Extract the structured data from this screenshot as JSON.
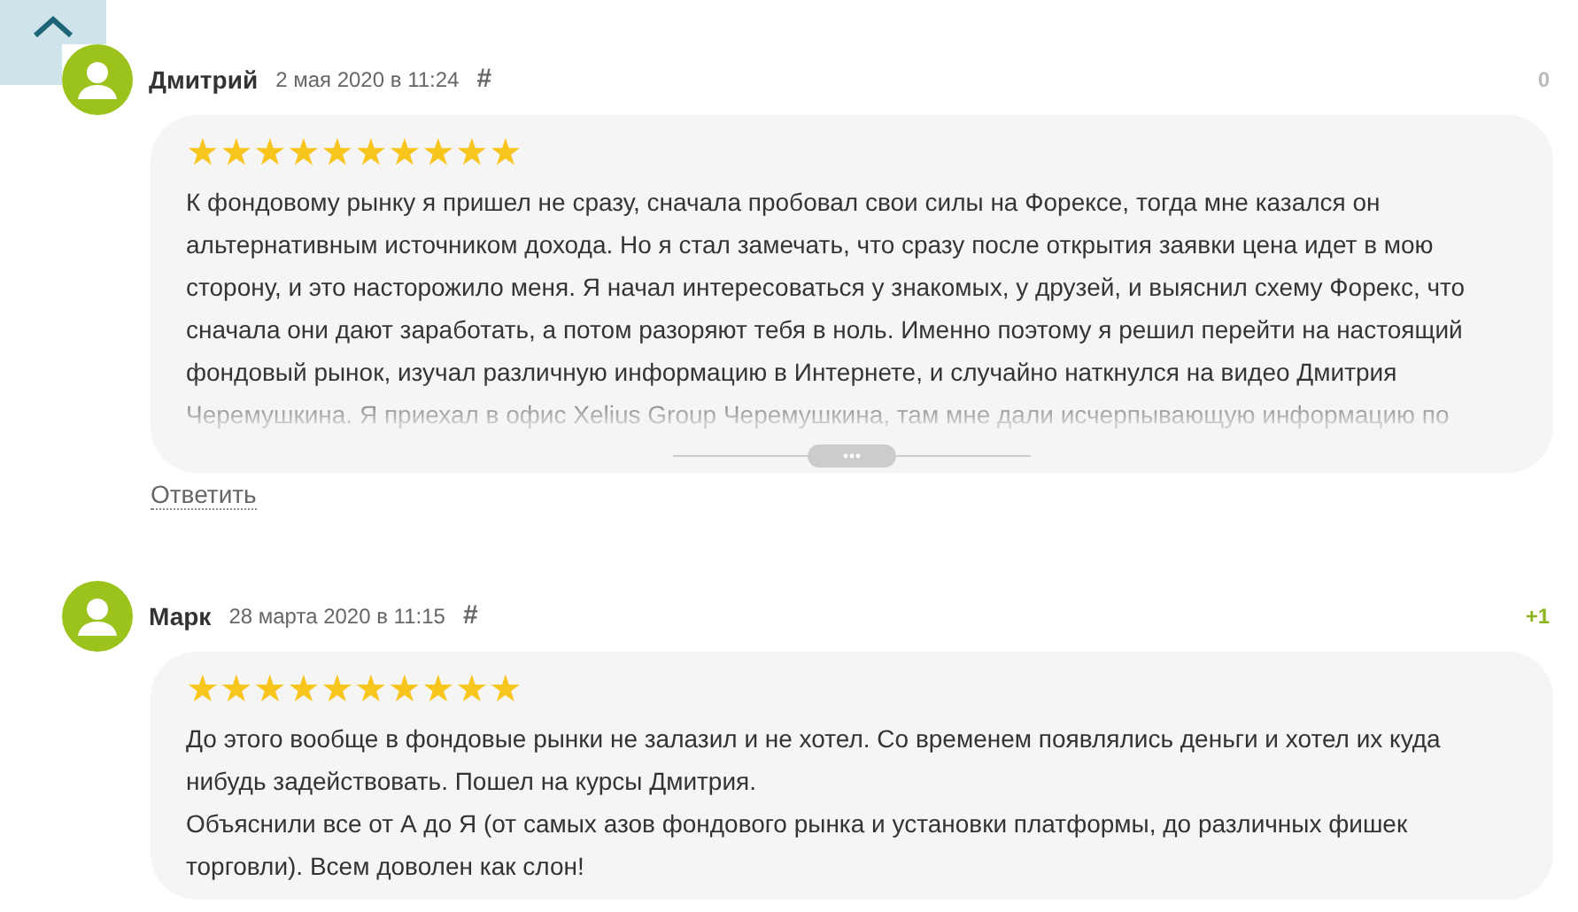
{
  "comments": [
    {
      "author": "Дмитрий",
      "date": "2 мая 2020 в 11:24",
      "anchor": "#",
      "score": "0",
      "score_positive": false,
      "stars": 10,
      "collapsed": true,
      "paragraphs": [
        "К фондовому рынку я пришел не сразу, сначала пробовал свои силы на Форексе, тогда мне казался он альтернативным источником дохода. Но я стал замечать, что сразу после открытия заявки цена идет в мою сторону, и это насторожило меня. Я начал интересоваться у знакомых, у друзей, и выяснил схему Форекс, что сначала они дают заработать, а потом разоряют тебя в ноль. Именно поэтому я решил перейти на настоящий фондовый рынок, изучал различную информацию в Интернете, и случайно наткнулся на видео Дмитрия Черемушкина. Я приехал в офис Xelius Group Черемушкина, там мне дали исчерпывающую информацию по"
      ],
      "reply": "Ответить"
    },
    {
      "author": "Марк",
      "date": "28 марта 2020 в 11:15",
      "anchor": "#",
      "score": "+1",
      "score_positive": true,
      "stars": 10,
      "collapsed": false,
      "paragraphs": [
        "До этого вообще в фондовые рынки не залазил и не хотел. Со временем появлялись деньги и хотел их куда нибудь задействовать. Пошел на курсы Дмитрия.",
        "Объяснили все от А до Я (от самых азов фондового рынка и установки платформы, до различных фишек торговли). Всем доволен как слон!"
      ]
    }
  ]
}
